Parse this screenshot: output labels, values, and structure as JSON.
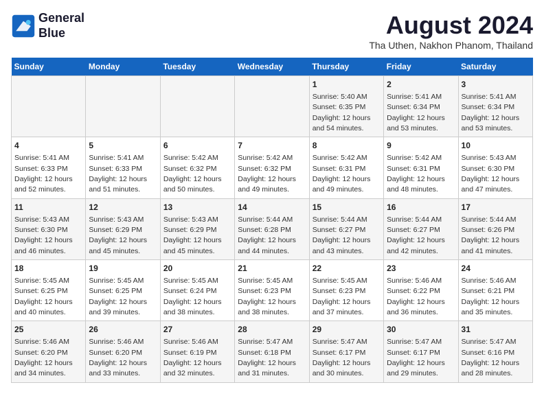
{
  "header": {
    "logo_line1": "General",
    "logo_line2": "Blue",
    "main_title": "August 2024",
    "subtitle": "Tha Uthen, Nakhon Phanom, Thailand"
  },
  "days_of_week": [
    "Sunday",
    "Monday",
    "Tuesday",
    "Wednesday",
    "Thursday",
    "Friday",
    "Saturday"
  ],
  "weeks": [
    [
      {
        "day": "",
        "info": ""
      },
      {
        "day": "",
        "info": ""
      },
      {
        "day": "",
        "info": ""
      },
      {
        "day": "",
        "info": ""
      },
      {
        "day": "1",
        "info": "Sunrise: 5:40 AM\nSunset: 6:35 PM\nDaylight: 12 hours and 54 minutes."
      },
      {
        "day": "2",
        "info": "Sunrise: 5:41 AM\nSunset: 6:34 PM\nDaylight: 12 hours and 53 minutes."
      },
      {
        "day": "3",
        "info": "Sunrise: 5:41 AM\nSunset: 6:34 PM\nDaylight: 12 hours and 53 minutes."
      }
    ],
    [
      {
        "day": "4",
        "info": "Sunrise: 5:41 AM\nSunset: 6:33 PM\nDaylight: 12 hours and 52 minutes."
      },
      {
        "day": "5",
        "info": "Sunrise: 5:41 AM\nSunset: 6:33 PM\nDaylight: 12 hours and 51 minutes."
      },
      {
        "day": "6",
        "info": "Sunrise: 5:42 AM\nSunset: 6:32 PM\nDaylight: 12 hours and 50 minutes."
      },
      {
        "day": "7",
        "info": "Sunrise: 5:42 AM\nSunset: 6:32 PM\nDaylight: 12 hours and 49 minutes."
      },
      {
        "day": "8",
        "info": "Sunrise: 5:42 AM\nSunset: 6:31 PM\nDaylight: 12 hours and 49 minutes."
      },
      {
        "day": "9",
        "info": "Sunrise: 5:42 AM\nSunset: 6:31 PM\nDaylight: 12 hours and 48 minutes."
      },
      {
        "day": "10",
        "info": "Sunrise: 5:43 AM\nSunset: 6:30 PM\nDaylight: 12 hours and 47 minutes."
      }
    ],
    [
      {
        "day": "11",
        "info": "Sunrise: 5:43 AM\nSunset: 6:30 PM\nDaylight: 12 hours and 46 minutes."
      },
      {
        "day": "12",
        "info": "Sunrise: 5:43 AM\nSunset: 6:29 PM\nDaylight: 12 hours and 45 minutes."
      },
      {
        "day": "13",
        "info": "Sunrise: 5:43 AM\nSunset: 6:29 PM\nDaylight: 12 hours and 45 minutes."
      },
      {
        "day": "14",
        "info": "Sunrise: 5:44 AM\nSunset: 6:28 PM\nDaylight: 12 hours and 44 minutes."
      },
      {
        "day": "15",
        "info": "Sunrise: 5:44 AM\nSunset: 6:27 PM\nDaylight: 12 hours and 43 minutes."
      },
      {
        "day": "16",
        "info": "Sunrise: 5:44 AM\nSunset: 6:27 PM\nDaylight: 12 hours and 42 minutes."
      },
      {
        "day": "17",
        "info": "Sunrise: 5:44 AM\nSunset: 6:26 PM\nDaylight: 12 hours and 41 minutes."
      }
    ],
    [
      {
        "day": "18",
        "info": "Sunrise: 5:45 AM\nSunset: 6:25 PM\nDaylight: 12 hours and 40 minutes."
      },
      {
        "day": "19",
        "info": "Sunrise: 5:45 AM\nSunset: 6:25 PM\nDaylight: 12 hours and 39 minutes."
      },
      {
        "day": "20",
        "info": "Sunrise: 5:45 AM\nSunset: 6:24 PM\nDaylight: 12 hours and 38 minutes."
      },
      {
        "day": "21",
        "info": "Sunrise: 5:45 AM\nSunset: 6:23 PM\nDaylight: 12 hours and 38 minutes."
      },
      {
        "day": "22",
        "info": "Sunrise: 5:45 AM\nSunset: 6:23 PM\nDaylight: 12 hours and 37 minutes."
      },
      {
        "day": "23",
        "info": "Sunrise: 5:46 AM\nSunset: 6:22 PM\nDaylight: 12 hours and 36 minutes."
      },
      {
        "day": "24",
        "info": "Sunrise: 5:46 AM\nSunset: 6:21 PM\nDaylight: 12 hours and 35 minutes."
      }
    ],
    [
      {
        "day": "25",
        "info": "Sunrise: 5:46 AM\nSunset: 6:20 PM\nDaylight: 12 hours and 34 minutes."
      },
      {
        "day": "26",
        "info": "Sunrise: 5:46 AM\nSunset: 6:20 PM\nDaylight: 12 hours and 33 minutes."
      },
      {
        "day": "27",
        "info": "Sunrise: 5:46 AM\nSunset: 6:19 PM\nDaylight: 12 hours and 32 minutes."
      },
      {
        "day": "28",
        "info": "Sunrise: 5:47 AM\nSunset: 6:18 PM\nDaylight: 12 hours and 31 minutes."
      },
      {
        "day": "29",
        "info": "Sunrise: 5:47 AM\nSunset: 6:17 PM\nDaylight: 12 hours and 30 minutes."
      },
      {
        "day": "30",
        "info": "Sunrise: 5:47 AM\nSunset: 6:17 PM\nDaylight: 12 hours and 29 minutes."
      },
      {
        "day": "31",
        "info": "Sunrise: 5:47 AM\nSunset: 6:16 PM\nDaylight: 12 hours and 28 minutes."
      }
    ]
  ]
}
